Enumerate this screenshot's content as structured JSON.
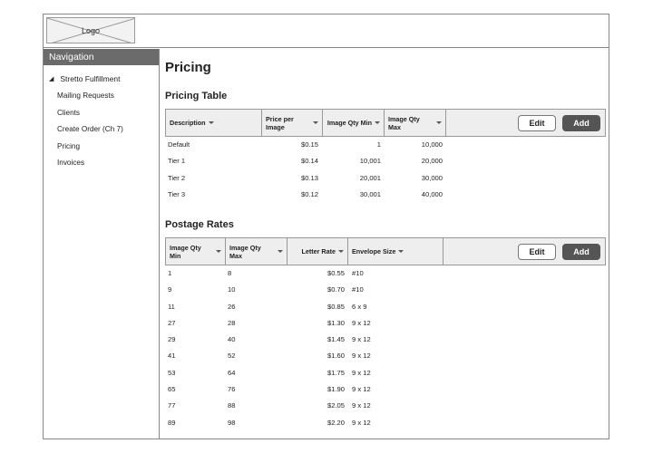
{
  "header": {
    "logo_label": "Logo"
  },
  "sidebar": {
    "title": "Navigation",
    "group": "Stretto Fulfillment",
    "items": [
      "Mailing Requests",
      "Clients",
      "Create Order (Ch 7)",
      "Pricing",
      "Invoices"
    ]
  },
  "main": {
    "page_title": "Pricing",
    "pricing_table": {
      "title": "Pricing Table",
      "columns": [
        "Description",
        "Price per Image",
        "Image Qty Min",
        "Image Qty Max"
      ],
      "edit_label": "Edit",
      "add_label": "Add",
      "rows": [
        [
          "Default",
          "$0.15",
          "1",
          "10,000"
        ],
        [
          "Tier 1",
          "$0.14",
          "10,001",
          "20,000"
        ],
        [
          "Tier 2",
          "$0.13",
          "20,001",
          "30,000"
        ],
        [
          "Tier 3",
          "$0.12",
          "30,001",
          "40,000"
        ]
      ]
    },
    "postage_table": {
      "title": "Postage Rates",
      "columns": [
        "Image Qty Min",
        "Image Qty Max",
        "Letter Rate",
        "Envelope Size"
      ],
      "edit_label": "Edit",
      "add_label": "Add",
      "rows": [
        [
          "1",
          "8",
          "$0.55",
          "#10"
        ],
        [
          "9",
          "10",
          "$0.70",
          "#10"
        ],
        [
          "11",
          "26",
          "$0.85",
          "6 x 9"
        ],
        [
          "27",
          "28",
          "$1.30",
          "9 x 12"
        ],
        [
          "29",
          "40",
          "$1.45",
          "9 x 12"
        ],
        [
          "41",
          "52",
          "$1.60",
          "9 x 12"
        ],
        [
          "53",
          "64",
          "$1.75",
          "9 x 12"
        ],
        [
          "65",
          "76",
          "$1.90",
          "9 x 12"
        ],
        [
          "77",
          "88",
          "$2.05",
          "9 x 12"
        ],
        [
          "89",
          "98",
          "$2.20",
          "9 x 12"
        ]
      ]
    }
  }
}
